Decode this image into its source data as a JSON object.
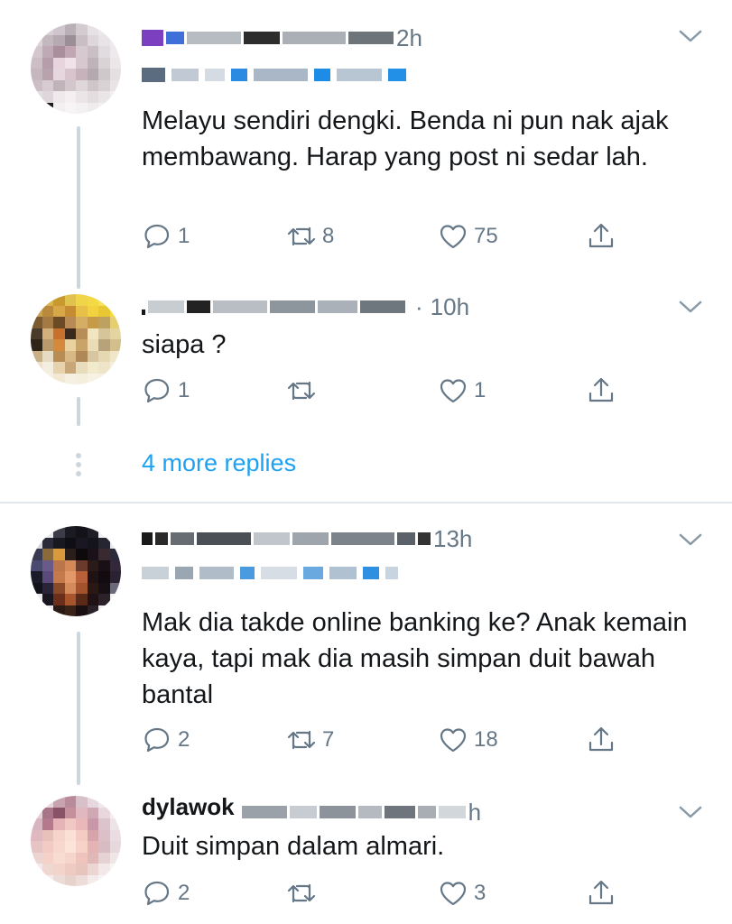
{
  "tweets": [
    {
      "time": "2h",
      "text": "Melayu sendiri dengki. Benda ni pun nak ajak membawang. Harap yang post ni sedar lah.",
      "reply_count": "1",
      "retweet_count": "8",
      "like_count": "75"
    },
    {
      "time": "10h",
      "text": "siapa ?",
      "reply_count": "1",
      "retweet_count": "",
      "like_count": "1"
    },
    {
      "time": "13h",
      "text": "Mak dia takde online banking ke? Anak kemain kaya, tapi mak dia masih simpan duit bawah bantal",
      "reply_count": "2",
      "retweet_count": "7",
      "like_count": "18"
    },
    {
      "name": "dylawok",
      "time": "h",
      "text": "Duit simpan dalam almari.",
      "reply_count": "2",
      "retweet_count": "",
      "like_count": "3"
    }
  ],
  "more_replies_label": "4 more replies",
  "icons": [
    "reply-icon",
    "retweet-icon",
    "like-icon",
    "share-icon",
    "caret-down-icon"
  ],
  "colors": {
    "text": "#14171a",
    "muted": "#657786",
    "link": "#1da1f2",
    "line": "#ccd6dd"
  }
}
